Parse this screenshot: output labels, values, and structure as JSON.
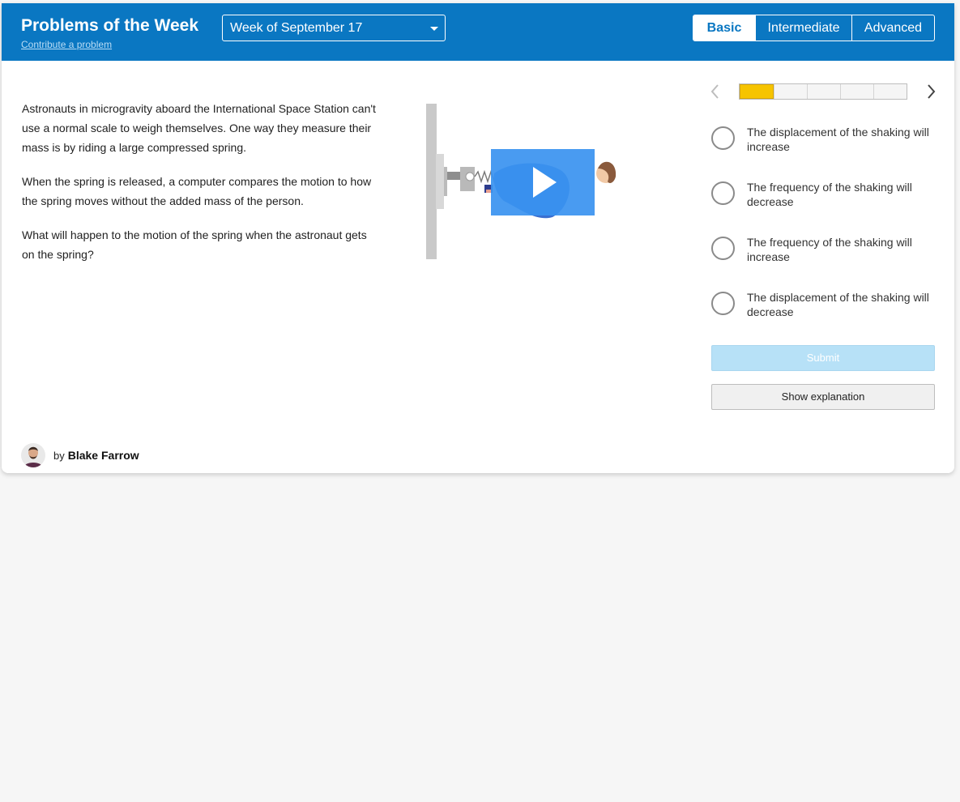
{
  "header": {
    "title": "Problems of the Week",
    "contribute_label": "Contribute a problem",
    "week_selected": "Week of September 17",
    "levels": [
      "Basic",
      "Intermediate",
      "Advanced"
    ],
    "active_level": "Basic",
    "background_color": "#0a77c2"
  },
  "problem": {
    "paragraphs": [
      "Astronauts in microgravity aboard the International Space Station can't use a normal scale to weigh themselves. One way they measure their mass is by riding a large compressed spring.",
      "When the spring is released, a computer compares the motion to how the spring moves without the added mass of the person.",
      "What will happen to the motion of the spring when the astronaut gets on the spring?"
    ],
    "video_icon": "play-icon"
  },
  "progress": {
    "total_segments": 5,
    "current": 1,
    "filled_color": "#f6c400"
  },
  "options": [
    "The displacement of the shaking will increase",
    "The frequency of the shaking will decrease",
    "The frequency of the shaking will increase",
    "The displacement of the shaking will decrease"
  ],
  "actions": {
    "submit_label": "Submit",
    "explanation_label": "Show explanation"
  },
  "author": {
    "by_label": "by",
    "name": "Blake Farrow"
  }
}
